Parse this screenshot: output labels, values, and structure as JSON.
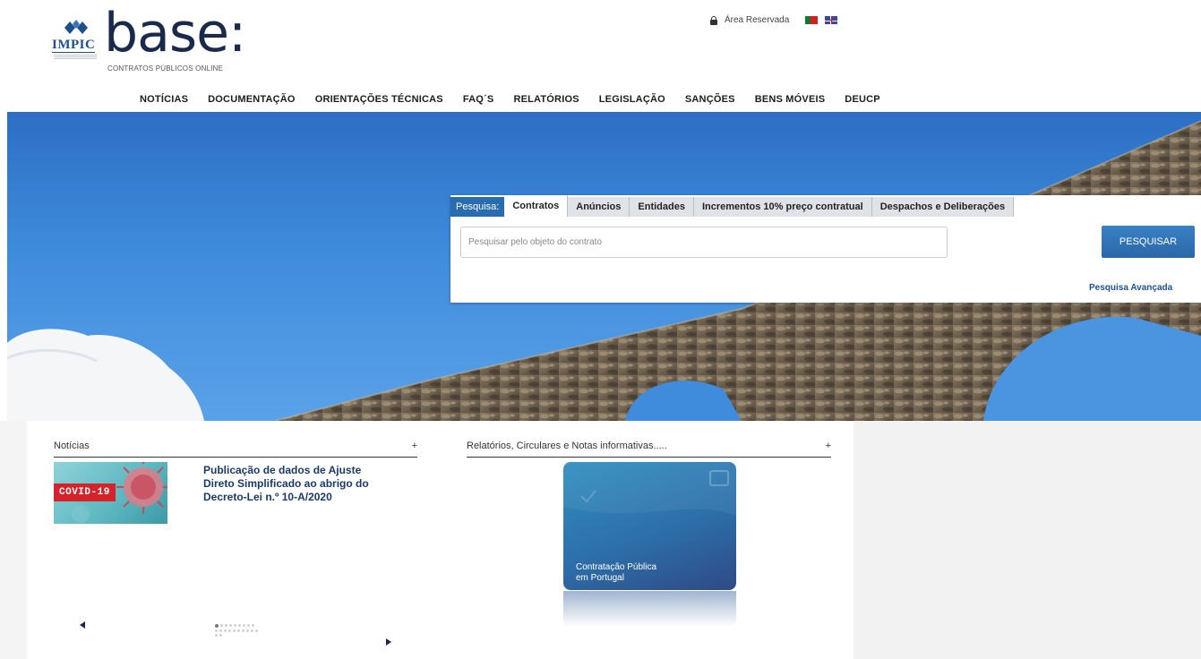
{
  "logo": {
    "impic": "IMPIC",
    "name": "base:",
    "tagline": "CONTRATOS PÚBLICOS ONLINE"
  },
  "topbar": {
    "reserved_area": "Área Reservada",
    "icons": [
      "lock-icon",
      "flag-pt-icon",
      "flag-uk-icon"
    ]
  },
  "nav": {
    "items": [
      "NOTÍCIAS",
      "DOCUMENTAÇÃO",
      "ORIENTAÇÕES TÉCNICAS",
      "FAQ´S",
      "RELATÓRIOS",
      "LEGISLAÇÃO",
      "SANÇÕES",
      "BENS MÓVEIS",
      "DEUCP"
    ]
  },
  "search": {
    "label": "Pesquisa:",
    "tabs": [
      "Contratos",
      "Anúncios",
      "Entidades",
      "Incrementos 10% preço contratual",
      "Despachos e Deliberações"
    ],
    "active_tab": "Contratos",
    "placeholder": "Pesquisar pelo objeto do contrato",
    "value": "",
    "button": "PESQUISAR",
    "advanced": "Pesquisa Avançada"
  },
  "news": {
    "heading": "Notícias",
    "plus": "+",
    "badge": "COVID-19",
    "title": "Publicação de dados de Ajuste Direto Simplificado ao abrigo do Decreto-Lei n.º 10-A/2020"
  },
  "reports": {
    "heading": "Relatórios, Circulares e Notas informativas.....",
    "plus": "+",
    "card_line1": "Contratação Pública",
    "card_line2": "em Portugal"
  },
  "colors": {
    "brand_dark": "#1a2a4d",
    "search_blue": "#2a6cb0",
    "news_title": "#1b3a66",
    "covid_red": "#d4232b"
  }
}
